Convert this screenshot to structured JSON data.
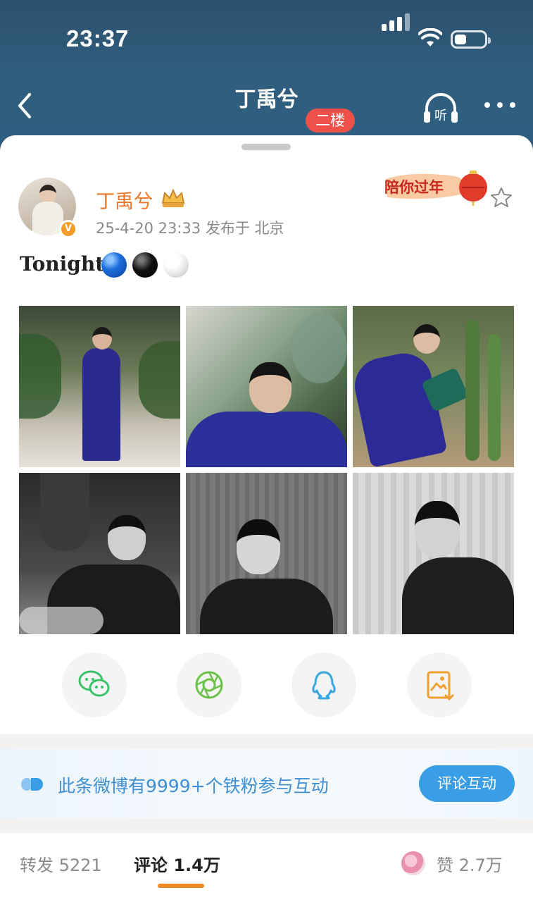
{
  "status_bar": {
    "time": "23:37"
  },
  "nav": {
    "title": "丁禹兮",
    "subtitle": "",
    "floor_badge": "二楼",
    "listen_label": "听"
  },
  "post": {
    "author": "丁禹兮",
    "meta": "25-4-20 23:33  发布于 北京",
    "banner": "陪你过年",
    "text": "Tonight",
    "emoji_colors": [
      "#1e6fdc",
      "#111111",
      "#eeeeee"
    ],
    "photos": [
      {
        "tone": "color",
        "alt": "photo-1"
      },
      {
        "tone": "color",
        "alt": "photo-2"
      },
      {
        "tone": "color",
        "alt": "photo-3"
      },
      {
        "tone": "bw",
        "alt": "photo-4"
      },
      {
        "tone": "bw",
        "alt": "photo-5"
      },
      {
        "tone": "bw",
        "alt": "photo-6"
      }
    ]
  },
  "share": {
    "icons": [
      "wechat-icon",
      "moments-icon",
      "qq-icon",
      "save-image-icon"
    ]
  },
  "fans": {
    "text": "此条微博有9999+个铁粉参与互动",
    "button": "评论互动"
  },
  "tabs": {
    "repost": "转发 5221",
    "comment": "评论 1.4万",
    "like": "赞 2.7万"
  },
  "colors": {
    "accent_orange": "#ec7624",
    "link_blue": "#3f8fd2",
    "badge_red": "#f0504a"
  }
}
